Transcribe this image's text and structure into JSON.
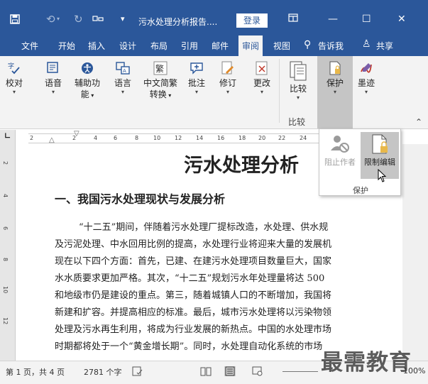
{
  "title_bar": {
    "doc_title": "污水处理分析报告....",
    "login_label": "登录",
    "quick_access": [
      "save-icon",
      "undo-icon",
      "redo-icon",
      "customize-icon",
      "dropdown-icon"
    ],
    "window_controls": [
      "ribbon-display-icon",
      "minimize-icon",
      "restore-icon",
      "close-icon"
    ]
  },
  "tabs": [
    "文件",
    "开始",
    "插入",
    "设计",
    "布局",
    "引用",
    "邮件",
    "审阅",
    "视图"
  ],
  "active_tab": "审阅",
  "tell_me": "告诉我",
  "share": "共享",
  "ribbon": {
    "buttons": {
      "proofing": "校对",
      "language": "语音",
      "accessibility_1": "辅助功",
      "accessibility_2": "能",
      "language2": "语言",
      "chinese_1": "中文简繁",
      "chinese_2": "转换",
      "comments": "批注",
      "tracking": "修订",
      "changes": "更改",
      "compare": "比较",
      "protect": "保护",
      "ink": "墨迹"
    },
    "group_compare_label": "比较"
  },
  "protect_popup": {
    "block_authors": "阻止作者",
    "restrict_editing": "限制编辑",
    "group_label": "保护"
  },
  "ruler": {
    "h_ticks": [
      "2",
      "2",
      "4",
      "6",
      "8",
      "10",
      "12",
      "14",
      "16",
      "18",
      "20",
      "22",
      "24"
    ],
    "v_ticks": [
      "2",
      "4",
      "6",
      "8",
      "10",
      "12"
    ]
  },
  "document": {
    "title": "污水处理分析",
    "heading": "一、我国污水处理现状与发展分析",
    "lines": [
      "“十二五”期间，伴随着污水处理厂提标改造，水处理、供水规",
      "及污泥处理、中水回用比例的提高，水处理行业将迎来大量的发展机",
      "现在以下四个方面：首先，已建、在建污水处理项目数量巨大，国家",
      "水水质要求更加严格。其次，“十二五”规划污水年处理量将达 500",
      "和地级市仍是建设的重点。第三，随着城镇人口的不断增加，我国将",
      "新建和扩容。并提高相应的标准。最后，城市污水处理将以污染物领",
      "处理及污水再生利用，将成为行业发展的新热点。中国的水处理市场",
      "时期都将处于一个“黄金增长期”。同时，水处理自动化系统的市场"
    ]
  },
  "status_bar": {
    "page_info": "第 1 页，共 4 页",
    "word_count": "2781 个字",
    "zoom": "100%"
  },
  "watermark": "最需教育",
  "colors": {
    "title_bar": "#2b579a",
    "ribbon_bg": "#f3f3f3",
    "active_button": "#c5c5c5"
  }
}
